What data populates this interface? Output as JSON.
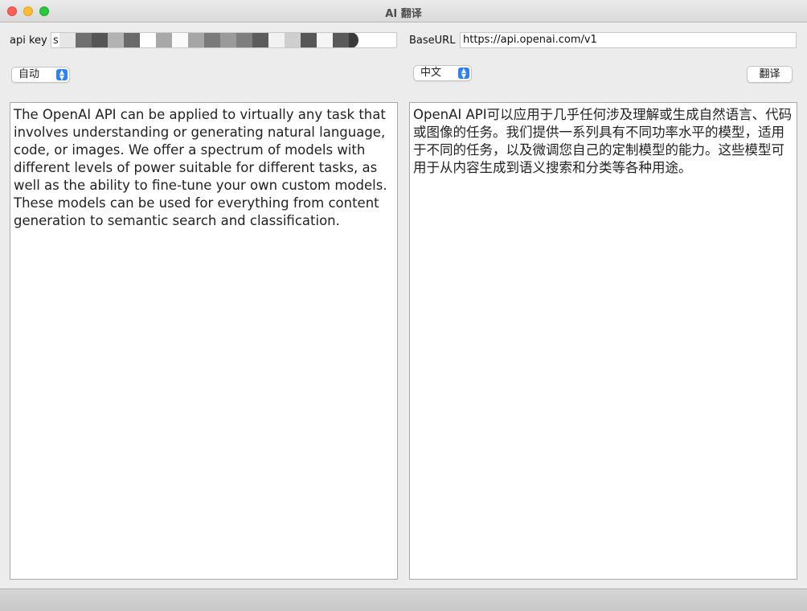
{
  "window": {
    "title": "AI 翻译"
  },
  "settings": {
    "api_key_label": "api key",
    "api_key_prefix": "s",
    "base_url_label": "BaseURL",
    "base_url_value": "https://api.openai.com/v1"
  },
  "source": {
    "language": "自动",
    "text": "The OpenAI API can be applied to virtually any task that involves understanding or generating natural language, code, or images. We offer a spectrum of models with different levels of power suitable for different tasks, as well as the ability to fine-tune your own custom models. These models can be used for everything from content generation to semantic search and classification."
  },
  "target": {
    "language": "中文",
    "text": "OpenAI API可以应用于几乎任何涉及理解或生成自然语言、代码或图像的任务。我们提供一系列具有不同功率水平的模型，适用于不同的任务，以及微调您自己的定制模型的能力。这些模型可用于从内容生成到语义搜索和分类等各种用途。"
  },
  "actions": {
    "translate_label": "翻译"
  },
  "icons": {
    "close": "close-button-icon",
    "minimize": "minimize-button-icon",
    "zoom": "zoom-button-icon",
    "stepper": "select-stepper-icon"
  }
}
